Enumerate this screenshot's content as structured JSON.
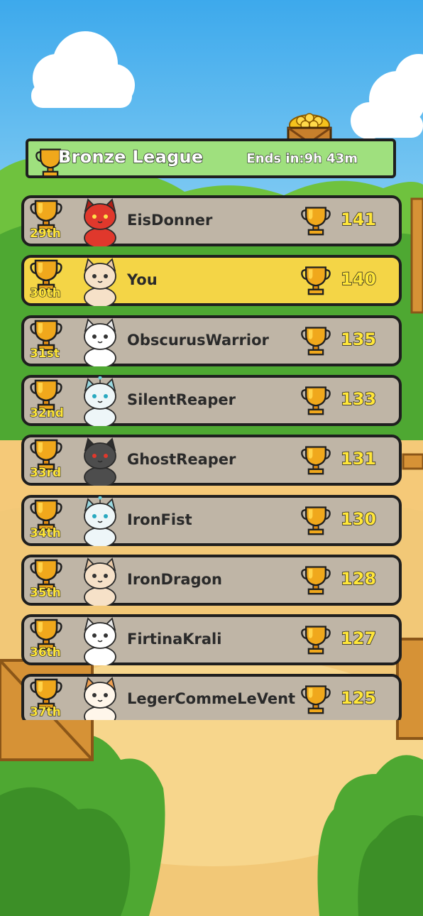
{
  "header": {
    "league_title": "Bronze League",
    "ends_in": "Ends in:9h 43m"
  },
  "leaderboard": [
    {
      "rank": "29th",
      "name": "EisDonner",
      "score": "141",
      "avatar": "red-devil-cat-icon",
      "is_me": false
    },
    {
      "rank": "30th",
      "name": "You",
      "score": "140",
      "avatar": "cream-cat-arms-crossed-icon",
      "is_me": true
    },
    {
      "rank": "31st",
      "name": "ObscurusWarrior",
      "score": "135",
      "avatar": "white-fluffy-cat-icon",
      "is_me": false
    },
    {
      "rank": "32nd",
      "name": "SilentReaper",
      "score": "133",
      "avatar": "robot-cat-icon",
      "is_me": false
    },
    {
      "rank": "33rd",
      "name": "GhostReaper",
      "score": "131",
      "avatar": "dark-gray-cat-icon",
      "is_me": false
    },
    {
      "rank": "34th",
      "name": "IronFist",
      "score": "130",
      "avatar": "robot-cat-icon",
      "is_me": false
    },
    {
      "rank": "35th",
      "name": "IronDragon",
      "score": "128",
      "avatar": "cream-cat-arms-crossed-icon",
      "is_me": false
    },
    {
      "rank": "36th",
      "name": "FirtinaKrali",
      "score": "127",
      "avatar": "white-fluffy-cat-icon",
      "is_me": false
    },
    {
      "rank": "37th",
      "name": "LegerCommeLeVent",
      "score": "125",
      "avatar": "calico-cat-waving-icon",
      "is_me": false
    }
  ],
  "colors": {
    "header_green": "#9fe07e",
    "row_gray": "#bfb5a6",
    "row_highlight": "#f4d546",
    "rank_text": "#ffe63a",
    "outline": "#1f1f1f"
  }
}
